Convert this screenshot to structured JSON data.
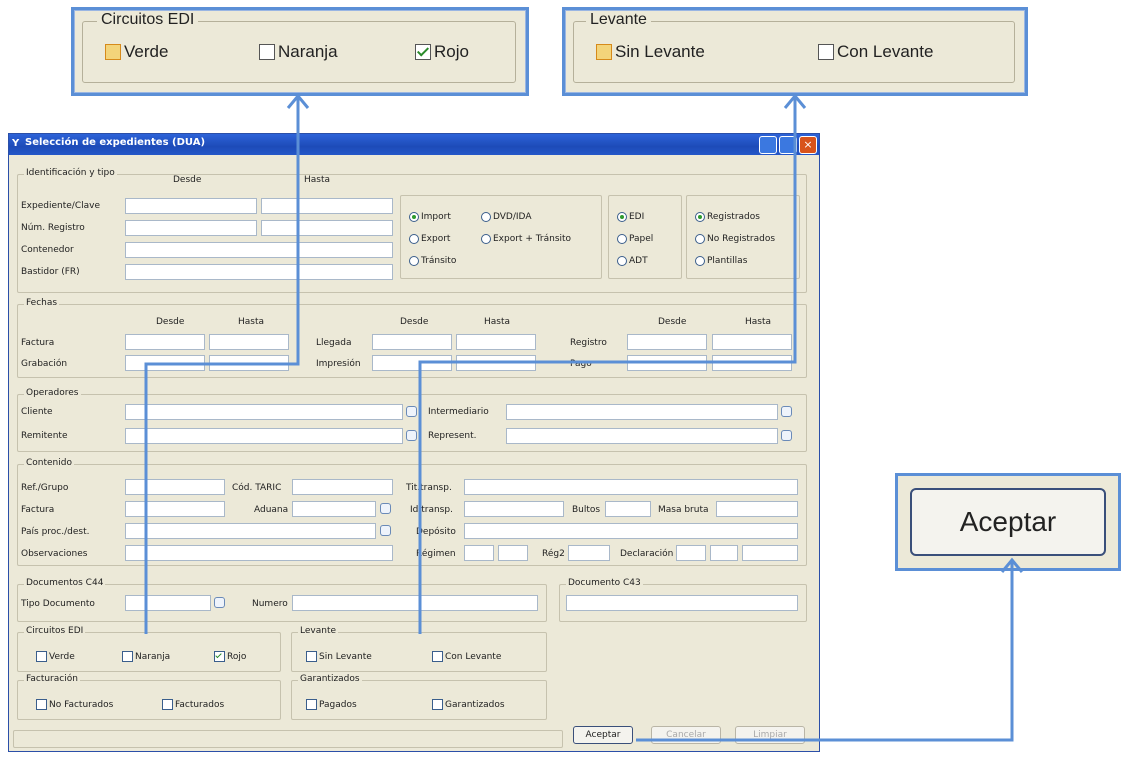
{
  "callouts": {
    "circuitos": {
      "legend": "Circuitos EDI",
      "items": [
        {
          "label": "Verde",
          "state": "orange"
        },
        {
          "label": "Naranja",
          "state": "empty"
        },
        {
          "label": "Rojo",
          "state": "checked"
        }
      ]
    },
    "levante": {
      "legend": "Levante",
      "items": [
        {
          "label": "Sin Levante",
          "state": "orange"
        },
        {
          "label": "Con Levante",
          "state": "empty"
        }
      ]
    },
    "aceptar": {
      "label": "Aceptar"
    }
  },
  "window": {
    "title": "Selección de expedientes (DUA)",
    "ident": {
      "legend": "Identificación y tipo",
      "desde": "Desde",
      "hasta": "Hasta",
      "rows": [
        "Expediente/Clave",
        "Núm. Registro",
        "Contenedor",
        "Bastidor (FR)"
      ],
      "tipo1": [
        "Import",
        "DVD/IDA",
        "Export",
        "Export + Tránsito",
        "Tránsito"
      ],
      "tipo2": [
        "EDI",
        "Papel",
        "ADT"
      ],
      "tipo3": [
        "Registrados",
        "No Registrados",
        "Plantillas"
      ]
    },
    "fechas": {
      "legend": "Fechas",
      "desde": "Desde",
      "hasta": "Hasta",
      "factura": "Factura",
      "grabacion": "Grabación",
      "llegada": "Llegada",
      "impresion": "Impresión",
      "registro": "Registro",
      "pago": "Pago"
    },
    "operadores": {
      "legend": "Operadores",
      "cliente": "Cliente",
      "remitente": "Remitente",
      "intermediario": "Intermediario",
      "represent": "Represent."
    },
    "contenido": {
      "legend": "Contenido",
      "ref": "Ref./Grupo",
      "factura": "Factura",
      "pais": "País proc./dest.",
      "obs": "Observaciones",
      "taric": "Cód. TARIC",
      "aduana": "Aduana",
      "tit": "Tit.transp.",
      "id": "Id.transp.",
      "bultos": "Bultos",
      "masa": "Masa bruta",
      "deposito": "Depósito",
      "regimen": "Régimen",
      "reg2": "Rég2",
      "declaracion": "Declaración"
    },
    "doc44": {
      "legend": "Documentos C44",
      "tipo": "Tipo Documento",
      "numero": "Numero"
    },
    "doc43": {
      "legend": "Documento C43"
    },
    "circuitos": {
      "legend": "Circuitos EDI",
      "verde": "Verde",
      "naranja": "Naranja",
      "rojo": "Rojo"
    },
    "levante": {
      "legend": "Levante",
      "sin": "Sin Levante",
      "con": "Con Levante"
    },
    "facturacion": {
      "legend": "Facturación",
      "no": "No Facturados",
      "si": "Facturados"
    },
    "garantizados": {
      "legend": "Garantizados",
      "pagados": "Pagados",
      "garantizados": "Garantizados"
    },
    "buttons": {
      "aceptar": "Aceptar",
      "cancelar": "Cancelar",
      "limpiar": "Limpiar"
    }
  },
  "colors": {
    "accent": "#5b8fd6",
    "window_bg": "#ece9d8",
    "titlebar": "#1d4bb8"
  }
}
